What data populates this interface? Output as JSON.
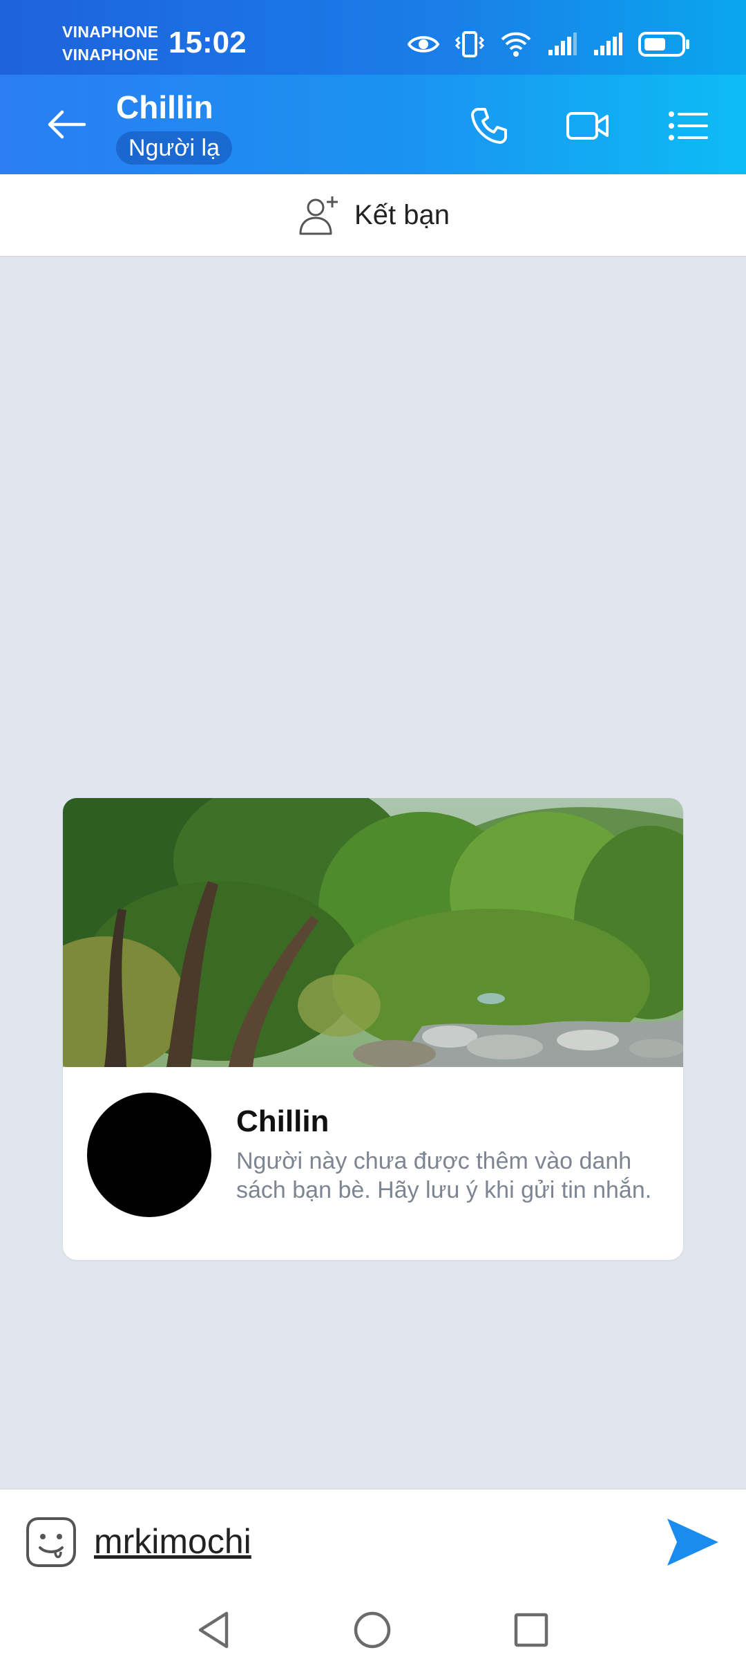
{
  "status_bar": {
    "carrier_1": "VINAPHONE",
    "carrier_2": "VINAPHONE",
    "time": "15:02",
    "battery_level": 0.6
  },
  "header": {
    "contact_name": "Chillin",
    "badge": "Người lạ",
    "icons": [
      "arrow-left-icon",
      "phone-icon",
      "video-camera-icon",
      "list-menu-icon"
    ]
  },
  "add_friend": {
    "label": "Kết bạn",
    "icon": "add-person-icon"
  },
  "profile_card": {
    "name": "Chillin",
    "note": "Người này chưa được thêm vào danh sách bạn bè. Hãy lưu ý khi gửi tin nhắn."
  },
  "composer": {
    "value": "mrkimochi",
    "icons": [
      "emoji-sticker-icon",
      "send-icon"
    ]
  },
  "nav": {
    "icons": [
      "nav-back-icon",
      "nav-home-icon",
      "nav-recents-icon"
    ]
  },
  "colors": {
    "header_gradient_start": "#2a7df2",
    "header_gradient_end": "#0dbcf4",
    "chat_background": "#e1e6ee",
    "send_blue": "#1a8cf0"
  }
}
